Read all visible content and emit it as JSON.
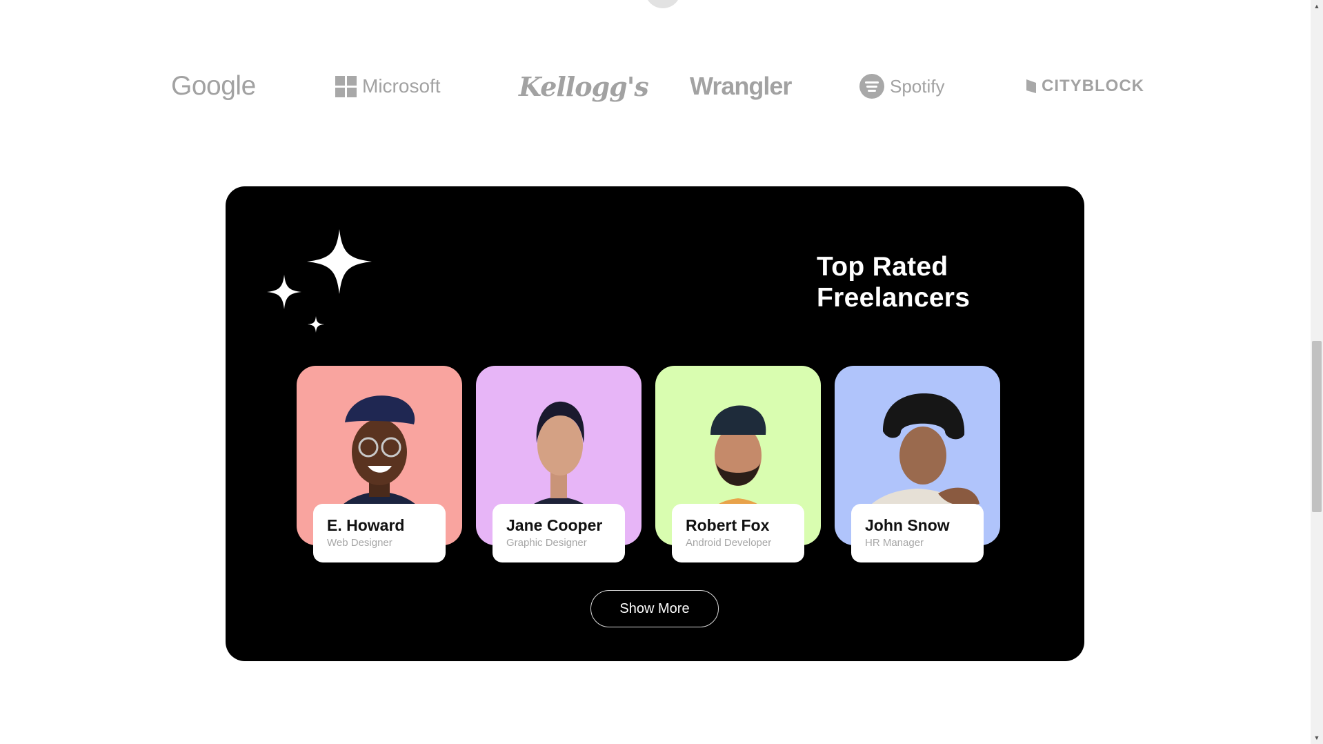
{
  "logos": [
    {
      "name": "Google"
    },
    {
      "name": "Microsoft"
    },
    {
      "name": "Kellogg's"
    },
    {
      "name": "Wrangler"
    },
    {
      "name": "Spotify"
    },
    {
      "name": "CITYBLOCK"
    }
  ],
  "section": {
    "title_line1": "Top Rated",
    "title_line2": "Freelancers",
    "show_more_label": "Show More"
  },
  "freelancers": [
    {
      "name": "E. Howard",
      "role": "Web Designer",
      "bg_color": "#f9a49f"
    },
    {
      "name": "Jane Cooper",
      "role": "Graphic Designer",
      "bg_color": "#e7b5f7"
    },
    {
      "name": "Robert Fox",
      "role": "Android Developer",
      "bg_color": "#d9fdb0"
    },
    {
      "name": "John Snow",
      "role": "HR Manager",
      "bg_color": "#b0c4fb"
    }
  ],
  "colors": {
    "panel_bg": "#000000",
    "logo_gray": "#a2a2a2"
  }
}
